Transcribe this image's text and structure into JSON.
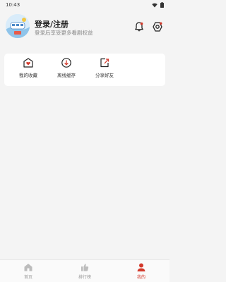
{
  "status_bar": {
    "time": "10:43"
  },
  "header": {
    "title": "登录/注册",
    "subtitle": "登录后享受更多看剧权益"
  },
  "quick_actions": [
    {
      "label": "我的收藏",
      "icon": "favorites-icon"
    },
    {
      "label": "离线缓存",
      "icon": "download-icon"
    },
    {
      "label": "分享好友",
      "icon": "share-icon"
    }
  ],
  "bottom_nav": [
    {
      "label": "首页",
      "icon": "home-icon",
      "active": false
    },
    {
      "label": "排行榜",
      "icon": "ranking-icon",
      "active": false
    },
    {
      "label": "我的",
      "icon": "profile-icon",
      "active": true
    }
  ],
  "colors": {
    "accent": "#d33a2c",
    "background": "#f4f4f4",
    "card": "#ffffff"
  }
}
